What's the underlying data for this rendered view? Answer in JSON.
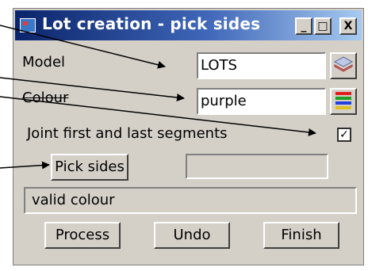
{
  "window": {
    "title": "Lot creation - pick sides",
    "controls": {
      "minimize": "_",
      "maximize": "□",
      "close": "X"
    }
  },
  "model": {
    "label": "Model",
    "value": "LOTS",
    "icon": "layers-icon"
  },
  "colour": {
    "label": "Colour",
    "value": "purple",
    "icon": "colour-bars-icon"
  },
  "joint": {
    "label": "Joint first and last segments",
    "checked": true,
    "check_glyph": "✓"
  },
  "pick": {
    "button_label": "Pick sides",
    "value": ""
  },
  "status": {
    "text": "valid colour"
  },
  "buttons": {
    "process": "Process",
    "undo": "Undo",
    "finish": "Finish"
  }
}
